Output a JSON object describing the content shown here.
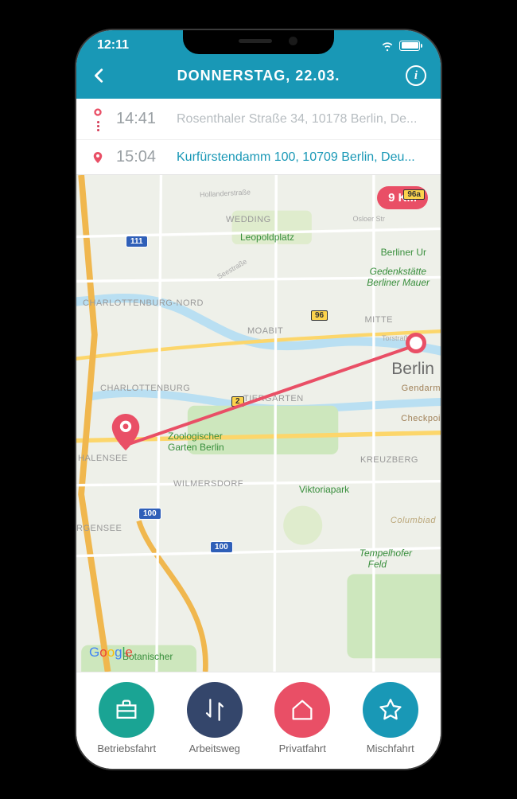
{
  "statusbar": {
    "time": "12:11"
  },
  "navbar": {
    "title": "DONNERSTAG, 22.03."
  },
  "trip": {
    "start": {
      "time": "14:41",
      "address": "Rosenthaler Straße 34, 10178 Berlin, De..."
    },
    "end": {
      "time": "15:04",
      "address": "Kurfürstendamm 100, 10709 Berlin, Deu..."
    }
  },
  "map": {
    "distance": "9 KM",
    "attribution": "Google",
    "labels": {
      "city": "Berlin",
      "wedding": "WEDDING",
      "moabit": "MOABIT",
      "mitte": "MITTE",
      "charlNord": "CHARLOTTENBURG-NORD",
      "charl": "CHARLOTTENBURG",
      "tiergarten": "TIERGARTEN",
      "wilmersdorf": "WILMERSDORF",
      "kreuzberg": "KREUZBERG",
      "halensee": "HALENSEE",
      "rgensee": "RGENSEE",
      "checkpoi": "Checkpoi",
      "gendarm": "Gendarm",
      "columbiad": "Columbiad",
      "leopold": "Leopoldplatz",
      "berlinerUr": "Berliner Ur",
      "gedenk1": "Gedenkstätte",
      "gedenk2": "Berliner Mauer",
      "zoo1": "Zoologischer",
      "zoo2": "Garten Berlin",
      "viktoria": "Viktoriapark",
      "tempel1": "Tempelhofer",
      "tempel2": "Feld",
      "botan": "Botanischer",
      "hollander": "Hollanderstraße",
      "osloer": "Osloer Str",
      "seestr": "Seestraße",
      "torstr": "Torstraße"
    },
    "shields": {
      "a111": "111",
      "a100a": "100",
      "a100b": "100",
      "b2": "2",
      "b96": "96",
      "b96a": "96a"
    }
  },
  "tabs": {
    "business": "Betriebsfahrt",
    "commute": "Arbeitsweg",
    "private": "Privatfahrt",
    "mixed": "Mischfahrt"
  }
}
